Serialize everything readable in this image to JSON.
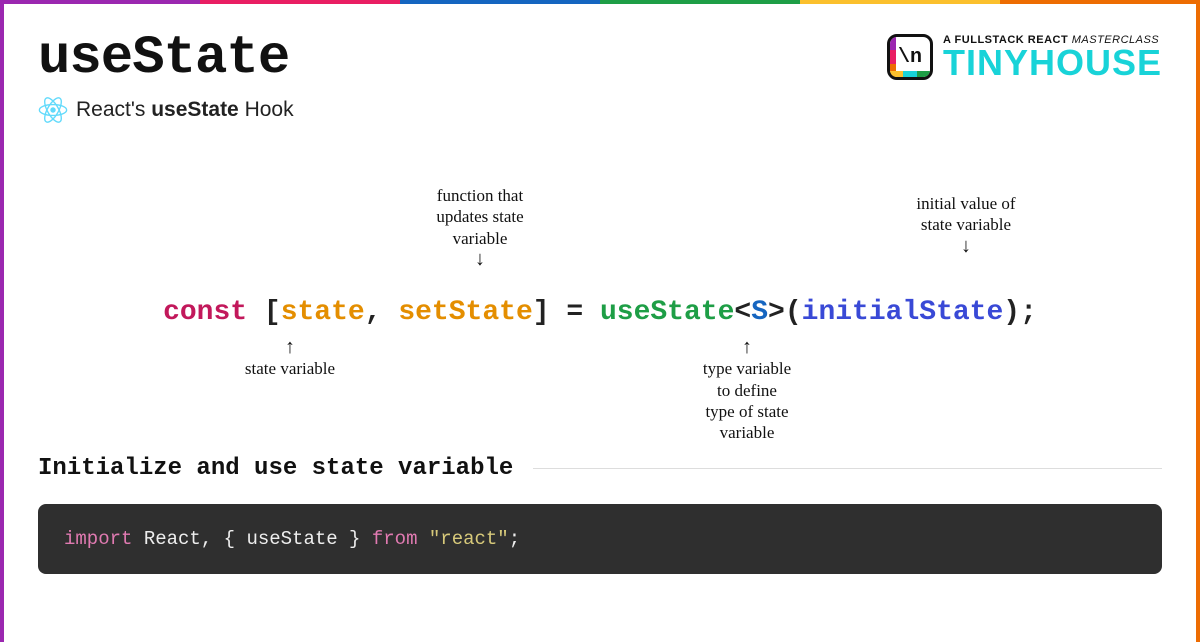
{
  "header": {
    "title": "useState",
    "subtitle_prefix": "React's ",
    "subtitle_bold": "useState",
    "subtitle_suffix": " Hook"
  },
  "brand": {
    "overline_bold": "A FULLSTACK REACT ",
    "overline_thin": "MASTERCLASS",
    "name": "TINYHOUSE",
    "logo_glyph": "\\n",
    "stripe_colors": [
      "#9b27b0",
      "#e91e63",
      "#ed6c02",
      "#fbc02d",
      "#18d3d8",
      "#1e9e46"
    ]
  },
  "diagram": {
    "annot_top_left": "function that\nupdates state\nvariable",
    "annot_top_right": "initial value of\nstate variable",
    "annot_bottom_left": "state variable",
    "annot_bottom_right": "type variable\nto define\ntype of state\nvariable",
    "tokens": {
      "const": "const",
      "open": " [",
      "state": "state",
      "comma": ", ",
      "setState": "setState",
      "close": "] ",
      "equals": "= ",
      "useState": "useState",
      "lt": "<",
      "S": "S",
      "gt": ">",
      "lparen": "(",
      "initialState": "initialState",
      "rparen": ")",
      "semi": ";"
    }
  },
  "section": {
    "title": "Initialize and use state variable"
  },
  "code": {
    "import_kw": "import",
    "react": " React, { useState } ",
    "from_kw": "from",
    "space": " ",
    "module": "\"react\"",
    "semi": ";"
  },
  "colors": {
    "top_stripes": [
      "#9b27b0",
      "#e91e63",
      "#1565c0",
      "#1e9e46",
      "#fbc02d",
      "#ed6c02"
    ]
  }
}
